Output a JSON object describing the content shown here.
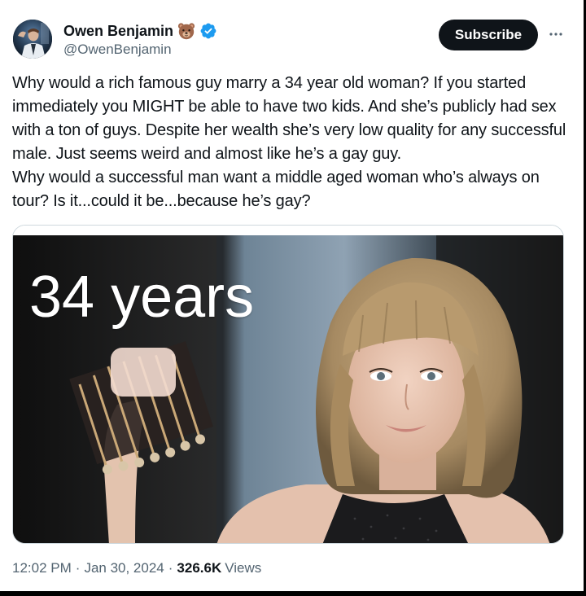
{
  "tweet": {
    "author": {
      "name": "Owen Benjamin",
      "handle": "@OwenBenjamin",
      "emoji_icon": "bear-face-icon",
      "verified_icon": "verified-badge-icon",
      "verified_color": "#1d9bf0"
    },
    "subscribe_label": "Subscribe",
    "more_icon": "more-horizontal-icon",
    "text": "Why would a rich famous guy marry a 34 year old woman? If you started immediately you MIGHT be able to have two kids. And she’s publicly had sex with a ton of guys. Despite her wealth she’s very low quality for any successful male. Just seems weird and almost like he’s a gay guy.\nWhy would a successful man want a middle aged woman who’s always on tour? Is it...could it be...because he’s gay?",
    "media": {
      "overlay_text": "34 years"
    },
    "meta": {
      "time": "12:02 PM",
      "date": "Jan 30, 2024",
      "separator": "·",
      "views_count": "326.6K",
      "views_label": "Views"
    }
  },
  "colors": {
    "text_primary": "#0f1419",
    "text_secondary": "#536471",
    "button_bg": "#0f1419",
    "border": "#cfd9de"
  }
}
